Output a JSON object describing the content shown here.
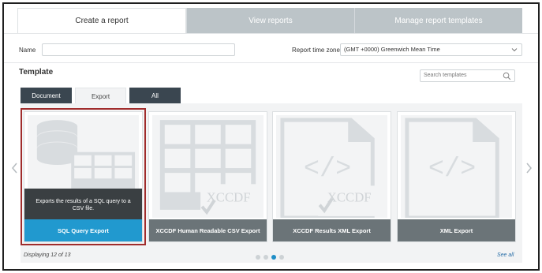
{
  "tabs": [
    {
      "label": "Create a report",
      "active": true
    },
    {
      "label": "View reports",
      "active": false
    },
    {
      "label": "Manage report templates",
      "active": false
    }
  ],
  "form": {
    "name_label": "Name",
    "name_value": "",
    "timezone_label": "Report time zone",
    "timezone_value": "(GMT +0000) Greenwich Mean Time"
  },
  "template": {
    "title": "Template",
    "search_placeholder": "Search templates",
    "filters": [
      {
        "label": "Document",
        "selected": false
      },
      {
        "label": "Export",
        "selected": true
      },
      {
        "label": "All",
        "selected": false
      }
    ],
    "cards": [
      {
        "label": "SQL Query Export",
        "description": "Exports the results of a SQL query to a CSV file.",
        "icon": "database-table-icon",
        "selected": true
      },
      {
        "label": "XCCDF Human Readable CSV Export",
        "icon": "xccdf-document-icon",
        "selected": false
      },
      {
        "label": "XCCDF Results XML Export",
        "icon": "xccdf-xml-file-icon",
        "selected": false
      },
      {
        "label": "XML Export",
        "icon": "xml-file-icon",
        "selected": false
      }
    ],
    "xccdf_text": "XCCDF",
    "xml_glyph": "</>",
    "displaying": "Displaying 12 of 13",
    "see_all": "See all",
    "pagination": {
      "pages": 4,
      "current": 3
    }
  },
  "colors": {
    "accent": "#2199cf",
    "selected_outline": "#a02c2c",
    "dark_tab": "#3a4650",
    "card_label": "#6b7478"
  }
}
